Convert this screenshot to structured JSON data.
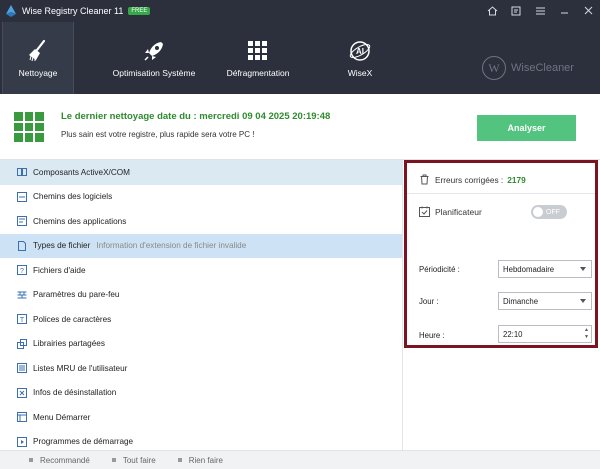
{
  "app": {
    "title": "Wise Registry Cleaner 11",
    "badge": "FREE",
    "accent": "#52c47f",
    "header_bg": "#2b303c"
  },
  "window_controls": [
    "home-icon",
    "feedback-icon",
    "menu-icon",
    "minimize-icon",
    "close-icon"
  ],
  "toolbar": {
    "items": [
      {
        "label": "Nettoyage",
        "icon": "broom-icon",
        "active": true
      },
      {
        "label": "Optimisation Système",
        "icon": "rocket-icon",
        "active": false
      },
      {
        "label": "Défragmentation",
        "icon": "defrag-grid-icon",
        "active": false
      },
      {
        "label": "WiseX",
        "icon": "wisex-icon",
        "active": false
      }
    ],
    "brand": "WiseCleaner",
    "brand_letter": "W"
  },
  "status": {
    "headline": "Le dernier nettoyage date du : mercredi 09 04 2025 20:19:48",
    "subtext": "Plus sain est votre registre, plus rapide sera votre PC !",
    "analyze_label": "Analyser"
  },
  "categories": [
    {
      "label": "Composants ActiveX/COM",
      "icon": "activex-icon",
      "description": ""
    },
    {
      "label": "Chemins des logiciels",
      "icon": "software-path-icon",
      "description": ""
    },
    {
      "label": "Chemins des applications",
      "icon": "app-path-icon",
      "description": ""
    },
    {
      "label": "Types de fichier",
      "icon": "file-type-icon",
      "description": "Information d'extension de fichier invalide"
    },
    {
      "label": "Fichiers d'aide",
      "icon": "help-file-icon",
      "description": ""
    },
    {
      "label": "Paramètres du pare-feu",
      "icon": "firewall-icon",
      "description": ""
    },
    {
      "label": "Polices de caractères",
      "icon": "font-icon",
      "description": ""
    },
    {
      "label": "Librairies partagées",
      "icon": "shared-library-icon",
      "description": ""
    },
    {
      "label": "Listes MRU de l'utilisateur",
      "icon": "mru-list-icon",
      "description": ""
    },
    {
      "label": "Infos de désinstallation",
      "icon": "uninstall-icon",
      "description": ""
    },
    {
      "label": "Menu Démarrer",
      "icon": "start-menu-icon",
      "description": ""
    },
    {
      "label": "Programmes de démarrage",
      "icon": "startup-program-icon",
      "description": ""
    }
  ],
  "panel": {
    "errors_label": "Erreurs corrigées :",
    "errors_count": "2179",
    "scheduler_label": "Planificateur",
    "toggle_state": "OFF",
    "frequency_label": "Périodicité :",
    "frequency_value": "Hebdomadaire",
    "day_label": "Jour :",
    "day_value": "Dimanche",
    "time_label": "Heure :",
    "time_value": "22:10",
    "border_color": "#7b1420"
  },
  "bottom": {
    "recommended": "Recommandé",
    "select_all": "Tout faire",
    "select_none": "Rien faire"
  }
}
